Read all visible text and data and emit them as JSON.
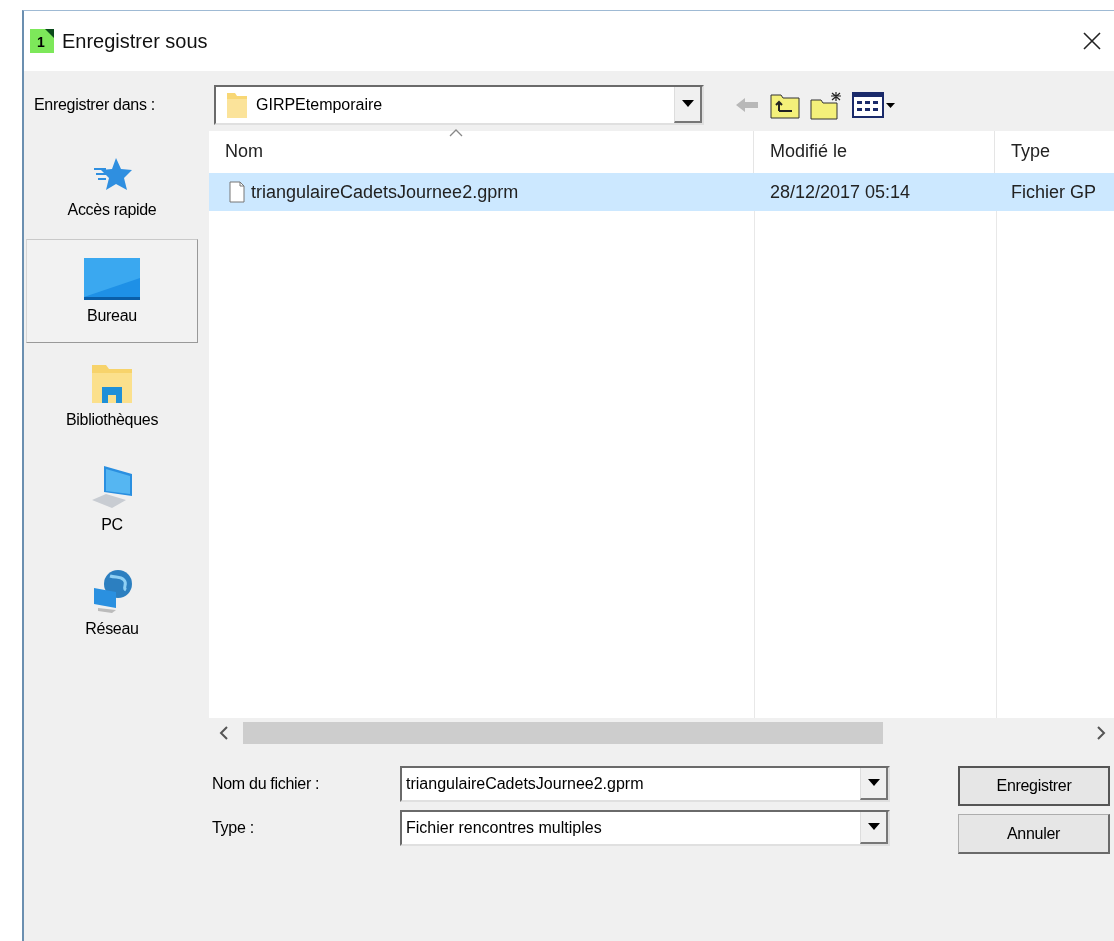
{
  "window": {
    "icon_text": "1",
    "title": "Enregistrer sous"
  },
  "save_in": {
    "label": "Enregistrer dans :",
    "value": "GIRPEtemporaire"
  },
  "places": [
    {
      "label": "Accès rapide",
      "kind": "star",
      "selected": false
    },
    {
      "label": "Bureau",
      "kind": "desktop",
      "selected": true
    },
    {
      "label": "Bibliothèques",
      "kind": "library",
      "selected": false
    },
    {
      "label": "PC",
      "kind": "pc",
      "selected": false
    },
    {
      "label": "Réseau",
      "kind": "network",
      "selected": false
    }
  ],
  "file_list": {
    "columns": [
      "Nom",
      "Modifié le",
      "Type"
    ],
    "rows": [
      {
        "name": "triangulaireCadetsJournee2.gprm",
        "modified": "28/12/2017 05:14",
        "type": "Fichier GP",
        "selected": true
      }
    ]
  },
  "filename": {
    "label": "Nom du fichier :",
    "value": "triangulaireCadetsJournee2.gprm"
  },
  "file_type": {
    "label": "Type :",
    "value": "Fichier rencontres multiples"
  },
  "buttons": [
    {
      "label": "Enregistrer",
      "default": true
    },
    {
      "label": "Annuler",
      "default": false
    }
  ]
}
